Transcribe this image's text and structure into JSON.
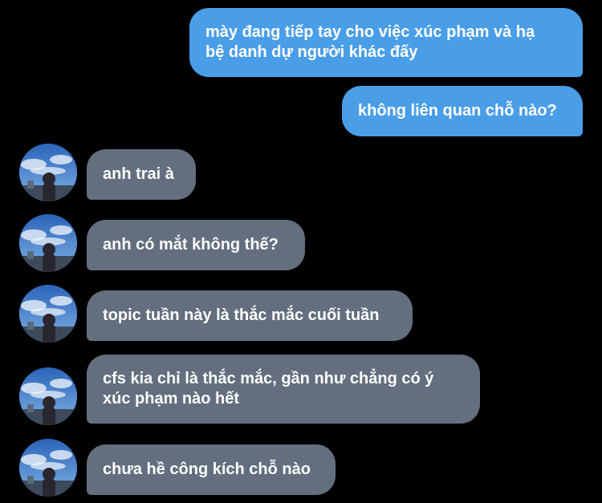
{
  "conversation": {
    "sent": [
      {
        "text": "mày đang tiếp tay cho việc xúc phạm và hạ\nbệ danh dự người khác đấy"
      },
      {
        "text": "không liên quan chỗ nào?"
      }
    ],
    "received": [
      {
        "text": "anh trai à",
        "avatar_icon": "contact-avatar"
      },
      {
        "text": "anh có mắt không thế?",
        "avatar_icon": "contact-avatar"
      },
      {
        "text": "topic tuần này là thắc mắc cuối tuần",
        "avatar_icon": "contact-avatar"
      },
      {
        "text": "cfs kia chỉ là thắc mắc, gần như chẳng có ý\nxúc phạm nào hết",
        "avatar_icon": "contact-avatar"
      },
      {
        "text": "chưa hề công kích chỗ nào",
        "avatar_icon": "contact-avatar"
      }
    ]
  },
  "colors": {
    "background": "#000000",
    "sent_bubble": "#4a9ee8",
    "received_bubble": "#636f7e",
    "text": "#ffffff"
  }
}
